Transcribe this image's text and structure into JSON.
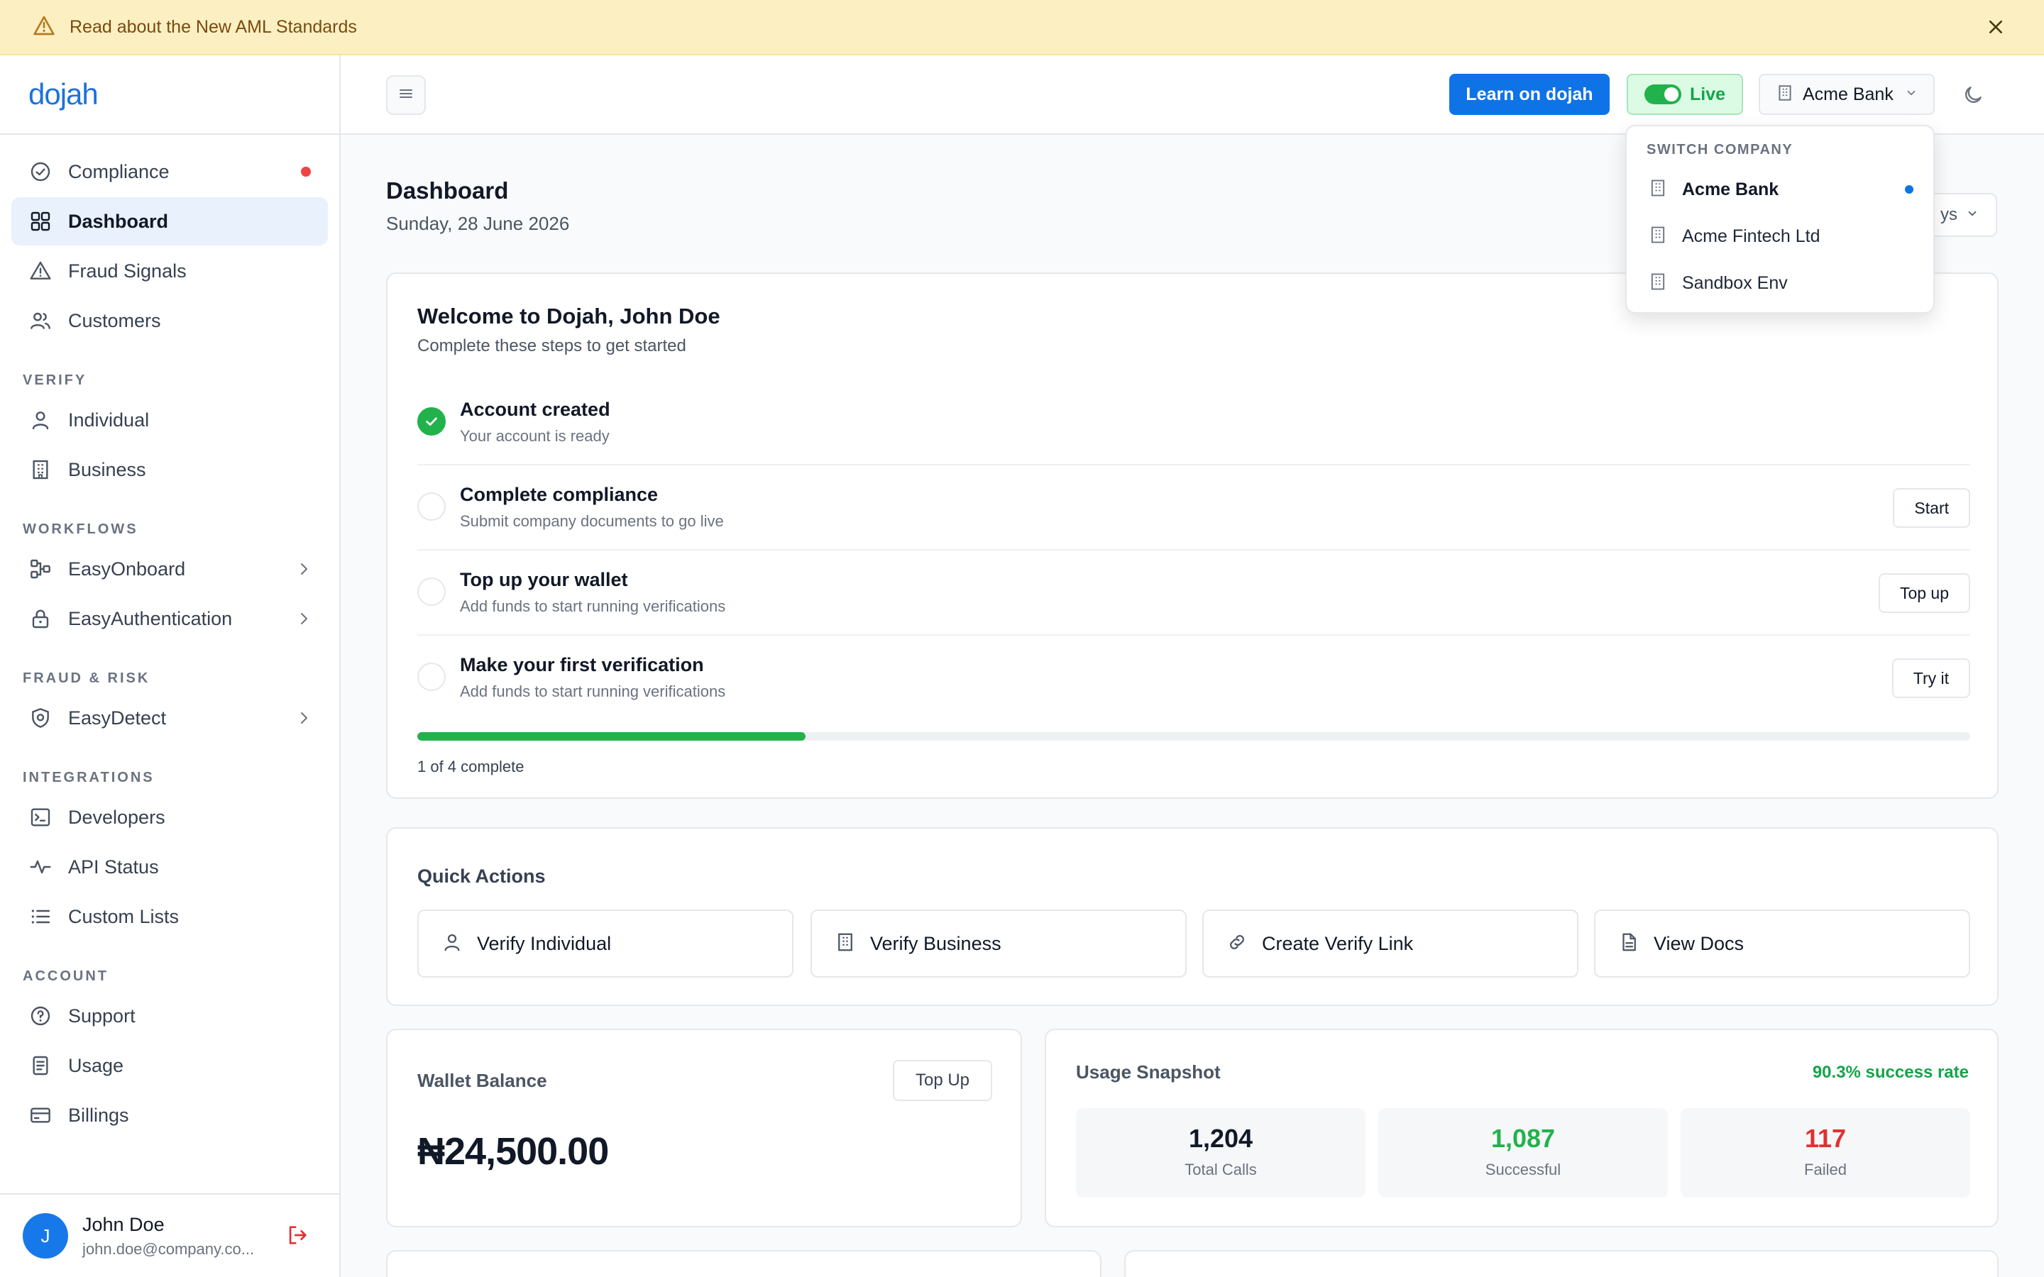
{
  "banner": {
    "text": "Read about the New AML Standards"
  },
  "brand": {
    "logo": "dojah"
  },
  "sidebar": {
    "items_top": [
      {
        "label": "Compliance",
        "icon": "check-circle-icon"
      },
      {
        "label": "Dashboard",
        "icon": "grid-icon"
      },
      {
        "label": "Fraud Signals",
        "icon": "warning-icon"
      },
      {
        "label": "Customers",
        "icon": "users-icon"
      }
    ],
    "sections": {
      "verify": "VERIFY",
      "workflows": "WORKFLOWS",
      "fraud_risk": "FRAUD & RISK",
      "integrations": "INTEGRATIONS",
      "account": "ACCOUNT"
    },
    "verify_items": [
      {
        "label": "Individual",
        "icon": "user-icon"
      },
      {
        "label": "Business",
        "icon": "building-icon"
      }
    ],
    "workflow_items": [
      {
        "label": "EasyOnboard",
        "icon": "flow-icon"
      },
      {
        "label": "EasyAuthentication",
        "icon": "lock-icon"
      }
    ],
    "fraud_items": [
      {
        "label": "EasyDetect",
        "icon": "shield-icon"
      }
    ],
    "integration_items": [
      {
        "label": "Developers",
        "icon": "terminal-icon"
      },
      {
        "label": "API Status",
        "icon": "pulse-icon"
      },
      {
        "label": "Custom Lists",
        "icon": "list-icon"
      }
    ],
    "account_items": [
      {
        "label": "Support",
        "icon": "help-icon"
      },
      {
        "label": "Usage",
        "icon": "document-icon"
      },
      {
        "label": "Billings",
        "icon": "card-icon"
      }
    ],
    "user": {
      "initial": "J",
      "name": "John Doe",
      "email": "john.doe@company.co..."
    }
  },
  "topbar": {
    "learn_label": "Learn on dojah",
    "live_label": "Live",
    "company": "Acme Bank"
  },
  "company_dropdown": {
    "header": "SWITCH COMPANY",
    "items": [
      {
        "name": "Acme Bank",
        "selected": true
      },
      {
        "name": "Acme Fintech Ltd",
        "selected": false
      },
      {
        "name": "Sandbox Env",
        "selected": false
      }
    ]
  },
  "page": {
    "title": "Dashboard",
    "date": "Sunday, 28 June 2026",
    "period_partial": "ys"
  },
  "welcome": {
    "title": "Welcome to Dojah, John Doe",
    "subtitle": "Complete these steps to get started",
    "steps": [
      {
        "title": "Account created",
        "subtitle": "Your account is ready",
        "done": true,
        "action": ""
      },
      {
        "title": "Complete compliance",
        "subtitle": "Submit company documents to go live",
        "done": false,
        "action": "Start"
      },
      {
        "title": "Top up your wallet",
        "subtitle": "Add funds to start running verifications",
        "done": false,
        "action": "Top up"
      },
      {
        "title": "Make your first verification",
        "subtitle": "Add funds to start running verifications",
        "done": false,
        "action": "Try it"
      }
    ],
    "progress_fraction": 0.25,
    "progress_text": "1 of 4 complete"
  },
  "quick_actions": {
    "title": "Quick Actions",
    "items": [
      {
        "label": "Verify Individual",
        "icon": "user-icon"
      },
      {
        "label": "Verify Business",
        "icon": "building-icon"
      },
      {
        "label": "Create Verify Link",
        "icon": "link-icon"
      },
      {
        "label": "View Docs",
        "icon": "document-icon"
      }
    ]
  },
  "wallet": {
    "title": "Wallet Balance",
    "button": "Top Up",
    "amount": "₦24,500.00"
  },
  "usage": {
    "title": "Usage Snapshot",
    "success_rate": "90.3% success rate",
    "stats": [
      {
        "value": "1,204",
        "label": "Total Calls",
        "color": "#111827"
      },
      {
        "value": "1,087",
        "label": "Successful",
        "color": "#22b24c"
      },
      {
        "value": "117",
        "label": "Failed",
        "color": "#e03131"
      }
    ]
  },
  "colors": {
    "primary": "#0f73e8",
    "success": "#22b24c",
    "danger": "#e03131",
    "banner_bg": "#fcf0c3"
  }
}
